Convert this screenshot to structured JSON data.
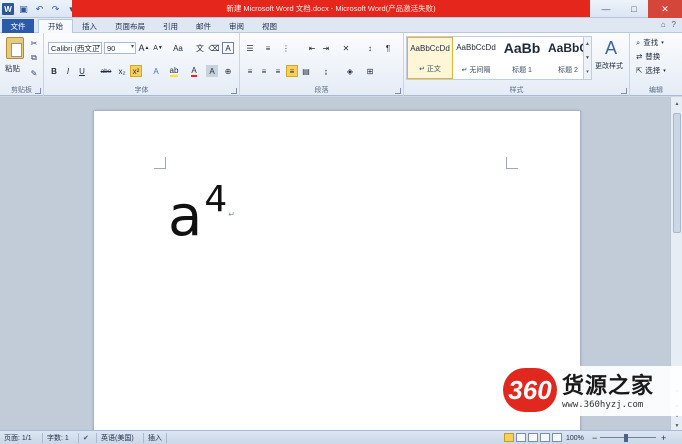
{
  "window": {
    "title": "新建 Microsoft Word 文档.docx - Microsoft Word(产品激活失败)",
    "qat": {
      "app_icon": "W",
      "save_icon": "save-icon",
      "undo_icon": "undo-icon",
      "redo_icon": "redo-icon"
    },
    "controls": {
      "minimize": "—",
      "maximize": "□",
      "close": "✕"
    }
  },
  "tabs": {
    "file": "文件",
    "items": [
      {
        "label": "开始",
        "active": true
      },
      {
        "label": "插入",
        "active": false
      },
      {
        "label": "页面布局",
        "active": false
      },
      {
        "label": "引用",
        "active": false
      },
      {
        "label": "邮件",
        "active": false
      },
      {
        "label": "审阅",
        "active": false
      },
      {
        "label": "视图",
        "active": false
      }
    ]
  },
  "ribbon": {
    "clipboard": {
      "label": "剪贴板",
      "paste": "粘贴"
    },
    "font": {
      "label": "字体",
      "font_name": "Calibri (西文正",
      "font_size": "90",
      "grow": "A",
      "shrink": "A",
      "change_case": "Aa",
      "bold": "B",
      "italic": "I",
      "underline": "U",
      "strikethrough": "abe",
      "subscript": "x₂",
      "superscript": "x²",
      "font_color": "A",
      "char_border": "A"
    },
    "paragraph": {
      "label": "段落"
    },
    "styles": {
      "label": "样式",
      "items": [
        {
          "sample": "AaBbCcDd",
          "name": "↵ 正文",
          "selected": true
        },
        {
          "sample": "AaBbCcDd",
          "name": "↵ 无间隔",
          "selected": false
        },
        {
          "sample": "AaBb",
          "name": "标题 1",
          "selected": false
        },
        {
          "sample": "AaBbC",
          "name": "标题 2",
          "selected": false
        }
      ],
      "change_styles": "更改样式"
    },
    "editing": {
      "label": "编辑",
      "find": "查找",
      "replace": "替换",
      "select": "选择"
    }
  },
  "document": {
    "base": "a",
    "superscript": "4",
    "paragraph_mark": "↵"
  },
  "watermark": {
    "logo": "360",
    "title": "货源之家",
    "url": "www.360hyzj.com"
  },
  "statusbar": {
    "page": "页面: 1/1",
    "words": "字数: 1",
    "language": "英语(美国)",
    "mode": "插入",
    "zoom": "100%",
    "zoom_out": "−",
    "zoom_in": "+"
  }
}
